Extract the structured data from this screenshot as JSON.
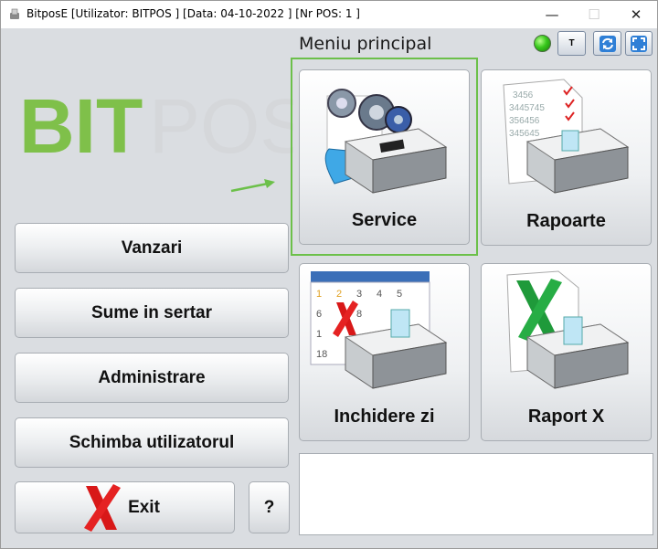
{
  "window": {
    "title": "BitposE [Utilizator: BITPOS ] [Data: 04-10-2022 ]  [Nr POS: 1 ]",
    "controls": {
      "minimize": "—",
      "maximize": "☐",
      "close": "✕"
    }
  },
  "logo": {
    "part1": "BIT",
    "part2": "POS",
    "color_bit": "#7fc04a",
    "color_pos": "#d5d7da"
  },
  "header": {
    "menu_title": "Meniu principal",
    "status_color": "#37c81c",
    "t_button": "T"
  },
  "left_menu": {
    "vanzari": "Vanzari",
    "sume": "Sume in sertar",
    "administrare": "Administrare",
    "schimba": "Schimba utilizatorul",
    "exit": "Exit",
    "help": "?"
  },
  "tiles": {
    "service": "Service",
    "rapoarte": "Rapoarte",
    "inchidere": "Inchidere zi",
    "raport_x": "Raport X"
  },
  "icons": {
    "service": "gears-printer-icon",
    "rapoarte": "report-printer-icon",
    "inchidere": "calendar-printer-icon",
    "raport_x": "excel-printer-icon",
    "exit": "red-x-icon",
    "refresh": "refresh-icon",
    "fullscreen": "fullscreen-icon"
  },
  "accent_color": "#6cc04a"
}
